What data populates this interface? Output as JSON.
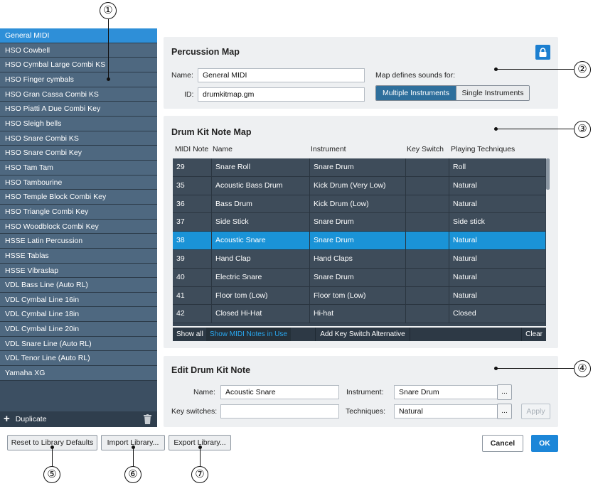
{
  "library": {
    "items": [
      "General MIDI",
      "HSO Cowbell",
      "HSO Cymbal Large Combi KS",
      "HSO Finger cymbals",
      "HSO Gran Cassa Combi KS",
      "HSO Piatti A Due Combi Key",
      "HSO Sleigh bells",
      "HSO Snare Combi KS",
      "HSO Snare Combi Key",
      "HSO Tam Tam",
      "HSO Tambourine",
      "HSO Temple Block Combi Key",
      "HSO Triangle Combi Key",
      "HSO Woodblock Combi Key",
      "HSSE Latin Percussion",
      "HSSE Tablas",
      "HSSE Vibraslap",
      "VDL Bass Line (Auto RL)",
      "VDL Cymbal Line 16in",
      "VDL Cymbal Line 18in",
      "VDL Cymbal Line 20in",
      "VDL Snare Line (Auto RL)",
      "VDL Tenor Line (Auto RL)",
      "Yamaha XG"
    ],
    "selected_index": 0,
    "duplicate_label": "Duplicate"
  },
  "percussion_map": {
    "title": "Percussion Map",
    "name_label": "Name:",
    "name_value": "General MIDI",
    "id_label": "ID:",
    "id_value": "drumkitmap.gm",
    "defines_label": "Map defines sounds for:",
    "multiple_label": "Multiple Instruments",
    "single_label": "Single Instruments",
    "selected_mode": "Multiple Instruments"
  },
  "drum_kit_map": {
    "title": "Drum Kit Note Map",
    "columns": [
      "MIDI Note",
      "Name",
      "Instrument",
      "Key Switch",
      "Playing Techniques"
    ],
    "rows": [
      [
        "29",
        "Snare Roll",
        "Snare Drum",
        "",
        "Roll"
      ],
      [
        "35",
        "Acoustic Bass Drum",
        "Kick Drum (Very Low)",
        "",
        "Natural"
      ],
      [
        "36",
        "Bass Drum",
        "Kick Drum (Low)",
        "",
        "Natural"
      ],
      [
        "37",
        "Side Stick",
        "Snare Drum",
        "",
        "Side stick"
      ],
      [
        "38",
        "Acoustic Snare",
        "Snare Drum",
        "",
        "Natural"
      ],
      [
        "39",
        "Hand Clap",
        "Hand Claps",
        "",
        "Natural"
      ],
      [
        "40",
        "Electric Snare",
        "Snare Drum",
        "",
        "Natural"
      ],
      [
        "41",
        "Floor tom (Low)",
        "Floor tom (Low)",
        "",
        "Natural"
      ],
      [
        "42",
        "Closed Hi-Hat",
        "Hi-hat",
        "",
        "Closed"
      ]
    ],
    "selected_row": 4,
    "show_all_label": "Show all",
    "show_midi_label": "Show MIDI Notes in Use",
    "add_key_switch_label": "Add Key Switch Alternative",
    "clear_label": "Clear"
  },
  "edit_note": {
    "title": "Edit Drum Kit Note",
    "name_label": "Name:",
    "name_value": "Acoustic Snare",
    "instrument_label": "Instrument:",
    "instrument_value": "Snare Drum",
    "key_switches_label": "Key switches:",
    "key_switches_value": "",
    "techniques_label": "Techniques:",
    "techniques_value": "Natural",
    "browse_label": "...",
    "apply_label": "Apply"
  },
  "footer": {
    "reset_label": "Reset to Library Defaults",
    "import_label": "Import Library...",
    "export_label": "Export Library...",
    "cancel_label": "Cancel",
    "ok_label": "OK"
  },
  "callouts": [
    "①",
    "②",
    "③",
    "④",
    "⑤",
    "⑥",
    "⑦"
  ],
  "colors": {
    "accent": "#1c86d8",
    "selection": "#1a93d7",
    "list_bg": "#4e6880",
    "table_bg": "#3e4c5a",
    "panel_bg": "#eef0f2"
  },
  "icons": {
    "add": "plus-icon",
    "delete": "trash-icon",
    "lock": "lock-icon"
  }
}
